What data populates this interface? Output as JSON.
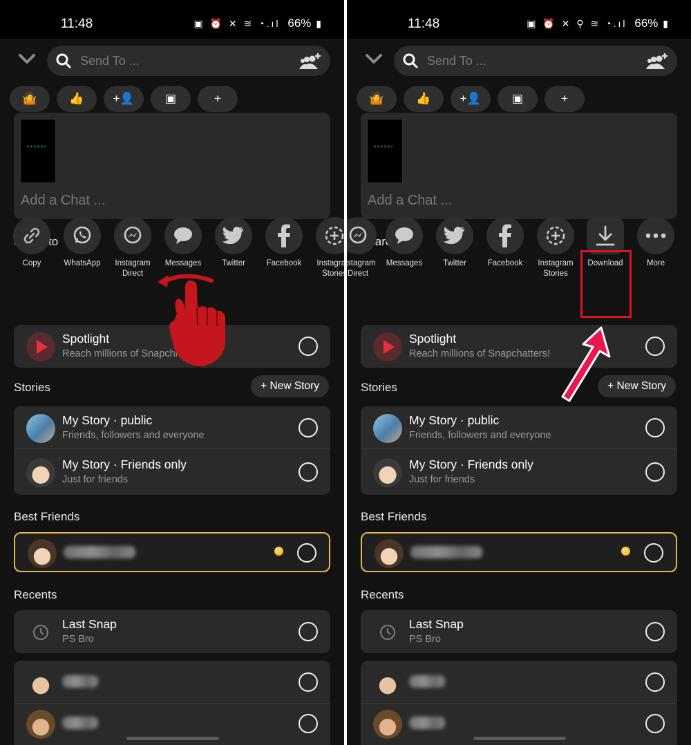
{
  "status": {
    "time": "11:48",
    "icons_left": "▣ ⏰ ✕ ≋ ◔.ıl",
    "icons_right": "▣ ⏰ ✕ ⚲ ≋ ◔.ıl",
    "battery": "66%"
  },
  "search": {
    "placeholder": "Send To ..."
  },
  "chips": [
    "🤷",
    "👍",
    "+👤",
    "▣",
    "+"
  ],
  "compose": {
    "placeholder": "Add a Chat ..."
  },
  "headings": {
    "share_to": "Share to",
    "stories": "Stories",
    "best_friends": "Best Friends",
    "recents": "Recents"
  },
  "share_left": [
    {
      "label": "Copy",
      "icon": "link-icon"
    },
    {
      "label": "WhatsApp",
      "icon": "whatsapp-icon"
    },
    {
      "label": "Instagram Direct",
      "icon": "messenger-icon"
    },
    {
      "label": "Messages",
      "icon": "messages-icon"
    },
    {
      "label": "Twitter",
      "icon": "twitter-icon"
    },
    {
      "label": "Facebook",
      "icon": "facebook-icon"
    },
    {
      "label": "Instagram Stories",
      "icon": "story-plus-icon"
    }
  ],
  "share_right": [
    {
      "label": "Instagram Direct",
      "icon": "messenger-icon"
    },
    {
      "label": "Messages",
      "icon": "messages-icon"
    },
    {
      "label": "Twitter",
      "icon": "twitter-icon"
    },
    {
      "label": "Facebook",
      "icon": "facebook-icon"
    },
    {
      "label": "Instagram Stories",
      "icon": "story-plus-icon"
    },
    {
      "label": "Download",
      "icon": "download-icon"
    },
    {
      "label": "More",
      "icon": "more-icon"
    }
  ],
  "spotlight": {
    "title": "Spotlight",
    "sub_left": "Reach millions of Snapchi",
    "sub_right": "Reach millions of Snapchatters!"
  },
  "new_story": "+ New Story",
  "stories": [
    {
      "title": "My Story · public",
      "sub": "Friends, followers and everyone"
    },
    {
      "title": "My Story · Friends only",
      "sub": "Just for friends"
    }
  ],
  "recents": [
    {
      "title": "Last Snap",
      "sub": "PS Bro"
    }
  ],
  "colors": {
    "accent_gold": "#e9b84a",
    "spotlight_red": "#e5323b",
    "highlight_red": "#d8151f",
    "arrow_pink": "#e8184f"
  }
}
